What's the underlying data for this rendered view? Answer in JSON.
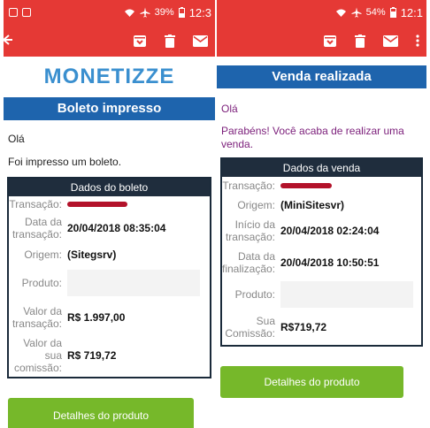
{
  "left": {
    "status": {
      "battery": "39%",
      "time": "12:3"
    },
    "logo": "MONETIZZE",
    "banner": "Boleto impresso",
    "greeting": "Olá",
    "message": "Foi impresso um boleto.",
    "card": {
      "title": "Dados do boleto",
      "rows": [
        {
          "label": "Transação:",
          "value": ""
        },
        {
          "label": "Data da transação:",
          "value": "20/04/2018 08:35:04"
        },
        {
          "label": "Origem:",
          "value": "(Sitegsrv)"
        },
        {
          "label": "Produto:",
          "value": ""
        },
        {
          "label": "Valor da transação:",
          "value": "R$ 1.997,00"
        },
        {
          "label": "Valor da sua comissão:",
          "value": "R$ 719,72"
        }
      ]
    },
    "button": "Detalhes do produto"
  },
  "right": {
    "status": {
      "battery": "54%",
      "time": "12:1"
    },
    "banner": "Venda realizada",
    "greeting": "Olá",
    "message": "Parabéns! Você acaba de realizar uma venda.",
    "card": {
      "title": "Dados da venda",
      "rows": [
        {
          "label": "Transação:",
          "value": ""
        },
        {
          "label": "Origem:",
          "value": "(MiniSitesvr)"
        },
        {
          "label": "Início da transação:",
          "value": "20/04/2018 02:24:04"
        },
        {
          "label": "Data da finalização:",
          "value": "20/04/2018 10:50:51"
        },
        {
          "label": "Produto:",
          "value": ""
        },
        {
          "label": "Sua Comissão:",
          "value": "R$719,72"
        }
      ]
    },
    "button": "Detalhes do produto"
  },
  "colors": {
    "toolbar": "#e53935",
    "banner": "#1e64ad",
    "card_header": "#1f2d3d",
    "button": "#76b82a",
    "logo": "#3a8fcf",
    "redaction": "#b3122a"
  },
  "icons": [
    "facebook-icon",
    "gallery-icon",
    "wifi-icon",
    "airplane-icon",
    "battery-icon",
    "back-arrow-icon",
    "archive-icon",
    "trash-icon",
    "mail-icon",
    "more-vert-icon"
  ]
}
